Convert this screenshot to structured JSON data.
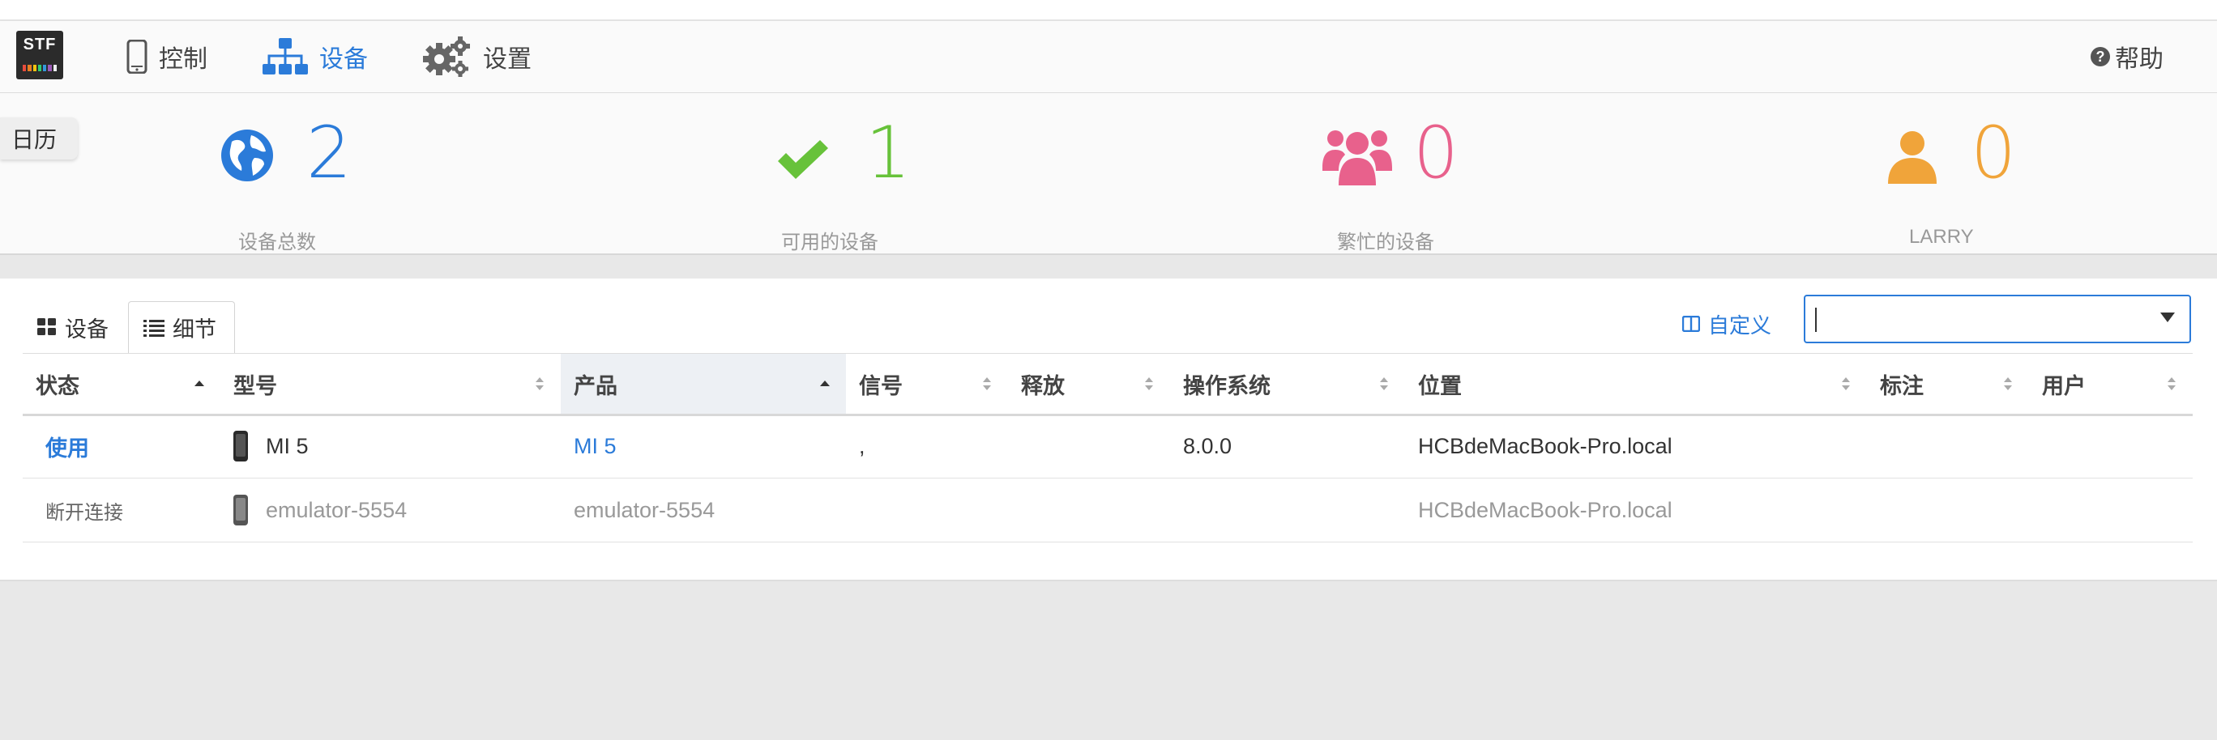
{
  "app": {
    "logo_text": "STF",
    "logo_colors": [
      "#e74c3c",
      "#e67e22",
      "#f1c40f",
      "#2ecc71",
      "#3498db",
      "#9b59b6",
      "#ecf0f1"
    ]
  },
  "nav": {
    "items": [
      {
        "label": "控制",
        "icon": "mobile-phone-icon"
      },
      {
        "label": "设备",
        "icon": "sitemap-icon",
        "active": true
      },
      {
        "label": "设置",
        "icon": "gears-icon"
      }
    ],
    "help_label": "帮助"
  },
  "calendar_tab": "日历",
  "stats": [
    {
      "value": "2",
      "caption": "设备总数",
      "icon": "globe-icon",
      "color": "#2b7bd9"
    },
    {
      "value": "1",
      "caption": "可用的设备",
      "icon": "check-icon",
      "color": "#67c23a"
    },
    {
      "value": "0",
      "caption": "繁忙的设备",
      "icon": "users-icon",
      "color": "#e8618c"
    },
    {
      "value": "0",
      "caption": "LARRY",
      "icon": "user-icon",
      "color": "#f0a43a"
    }
  ],
  "tabs": [
    {
      "label": "设备",
      "icon": "th-large-icon"
    },
    {
      "label": "细节",
      "icon": "list-icon",
      "selected": true
    }
  ],
  "customize_label": "自定义",
  "search": {
    "value": "",
    "placeholder": ""
  },
  "table": {
    "columns": [
      "状态",
      "型号",
      "产品",
      "信号",
      "释放",
      "操作系统",
      "位置",
      "标注",
      "用户"
    ],
    "rows": [
      {
        "status": "使用",
        "model": "MI 5",
        "product": "MI 5",
        "signal": ",",
        "release": "",
        "os": "8.0.0",
        "location": "HCBdeMacBook-Pro.local",
        "notes": "",
        "user": ""
      },
      {
        "status": "断开连接",
        "model": "emulator-5554",
        "product": "emulator-5554",
        "signal": "",
        "release": "",
        "os": "",
        "location": "HCBdeMacBook-Pro.local",
        "notes": "",
        "user": ""
      }
    ]
  },
  "colors": {
    "accent": "#2b7bd9"
  }
}
